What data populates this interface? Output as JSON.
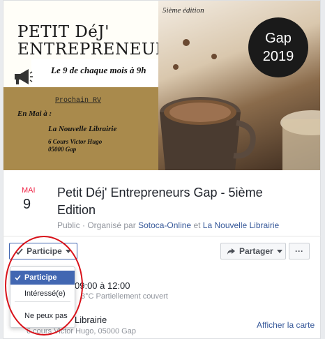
{
  "cover": {
    "title_line1": "PETIT DéJ'",
    "title_line2": "ENTREPRENEURS",
    "monthly": "Le 9 de chaque mois à 9h",
    "next_label": "Prochain RV",
    "month_label": "En Mai à :",
    "venue": "La Nouvelle Librairie",
    "address_line1": "6 Cours Victor Hugo",
    "address_line2": "05000 Gap",
    "edition": "5ième édition",
    "badge_line1": "Gap",
    "badge_line2": "2019"
  },
  "event": {
    "month": "MAI",
    "day": "9",
    "title": "Petit Déj' Entrepreneurs Gap - 5ième Edition",
    "privacy": "Public",
    "organized_prefix": " · Organisé par ",
    "organizer1": "Sotoca-Online",
    "organizer_join": " et ",
    "organizer2": "La Nouvelle Librairie"
  },
  "actions": {
    "participe_label": "Participe",
    "share_label": "Partager",
    "more_label": "···"
  },
  "dropdown": {
    "items": [
      "Participe",
      "Intéressé(e)",
      "Ne peux pas"
    ]
  },
  "details": {
    "time": "09:00 à 12:00",
    "weather": "3°C Partiellement couvert",
    "place": "Librairie",
    "address": "6 cours Victor Hugo, 05000 Gap",
    "map_link": "Afficher la carte"
  },
  "colors": {
    "accent": "#4267b2",
    "link": "#365899",
    "date_red": "#f02849",
    "annotation_red": "#d9121a"
  }
}
